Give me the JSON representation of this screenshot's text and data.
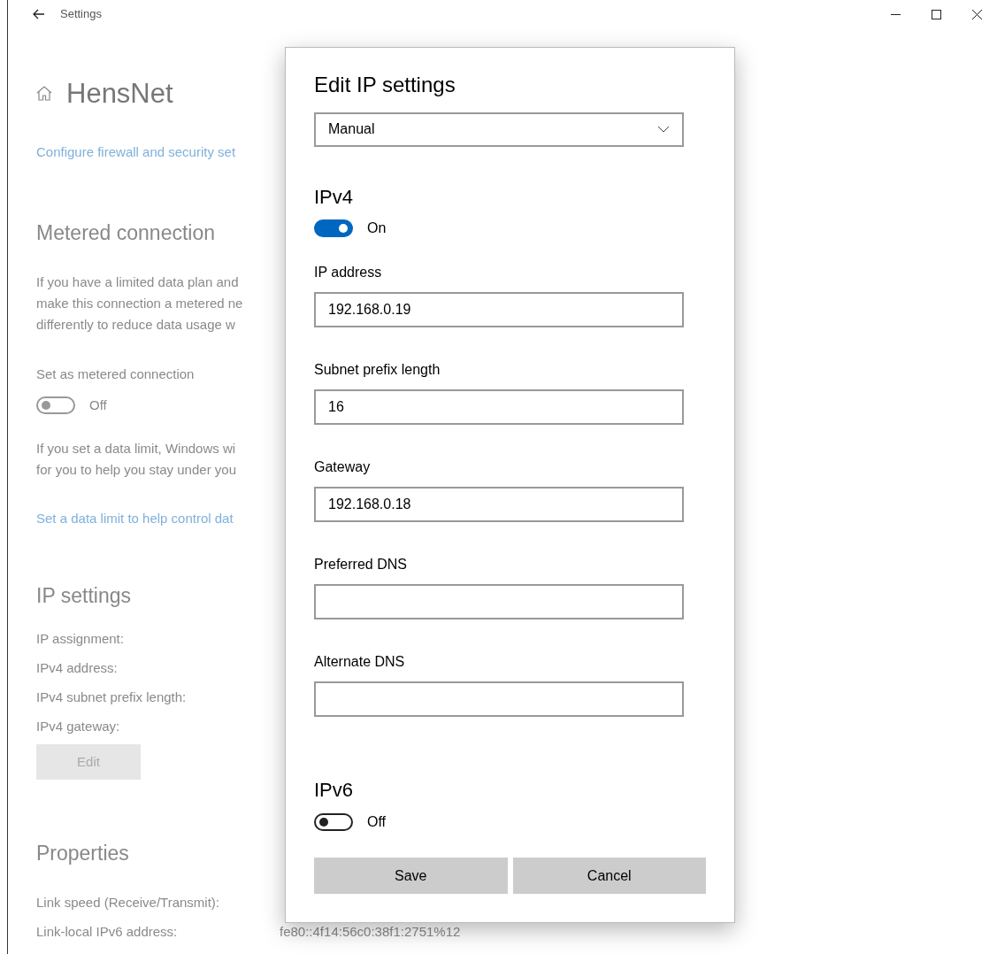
{
  "window": {
    "title": "Settings"
  },
  "page": {
    "title": "HensNet",
    "link_top": "Configure firewall and security set",
    "metered": {
      "heading": "Metered connection",
      "paragraph": [
        "If you have a limited data plan and",
        "make this connection a metered ne",
        "differently to reduce data usage w"
      ],
      "toggle_label": "Set as metered connection",
      "toggle": {
        "on": false,
        "state_text": "Off"
      },
      "note": [
        "If you set a data limit, Windows wi",
        "for you to help you stay under you"
      ],
      "link": "Set a data limit to help control dat"
    },
    "ip_settings": {
      "heading": "IP settings",
      "rows": [
        {
          "label": "IP assignment:"
        },
        {
          "label": "IPv4 address:"
        },
        {
          "label": "IPv4 subnet prefix length:"
        },
        {
          "label": "IPv4 gateway:"
        }
      ],
      "edit_button": {
        "label": "Edit",
        "disabled": true
      }
    },
    "properties": {
      "heading": "Properties",
      "rows": [
        {
          "label": "Link speed (Receive/Transmit):"
        },
        {
          "label": "Link-local IPv6 address:",
          "value": "fe80::4f14:56c0:38f1:2751%12"
        }
      ]
    }
  },
  "dialog": {
    "title": "Edit IP settings",
    "mode": "Manual",
    "ipv4": {
      "heading": "IPv4",
      "toggle": {
        "on": true,
        "state_text": "On"
      },
      "fields": [
        {
          "label": "IP address",
          "value": "192.168.0.19"
        },
        {
          "label": "Subnet prefix length",
          "value": "16"
        },
        {
          "label": "Gateway",
          "value": "192.168.0.18"
        },
        {
          "label": "Preferred DNS"
        },
        {
          "label": "Alternate DNS"
        }
      ]
    },
    "ipv6": {
      "heading": "IPv6",
      "toggle": {
        "on": false,
        "state_text": "Off"
      }
    },
    "buttons": [
      "Save",
      "Cancel"
    ]
  }
}
